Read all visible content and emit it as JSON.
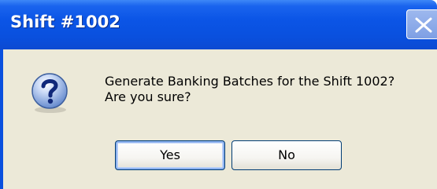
{
  "window": {
    "title": "Shift #1002"
  },
  "dialog": {
    "icon": "question-icon",
    "message_line1": "Generate Banking Batches for the Shift 1002?",
    "message_line2": "Are you sure?"
  },
  "buttons": {
    "yes_label": "Yes",
    "no_label": "No"
  },
  "colors": {
    "titlebar": "#0a50de",
    "client_bg": "#ece9d8",
    "button_border": "#003c74"
  }
}
